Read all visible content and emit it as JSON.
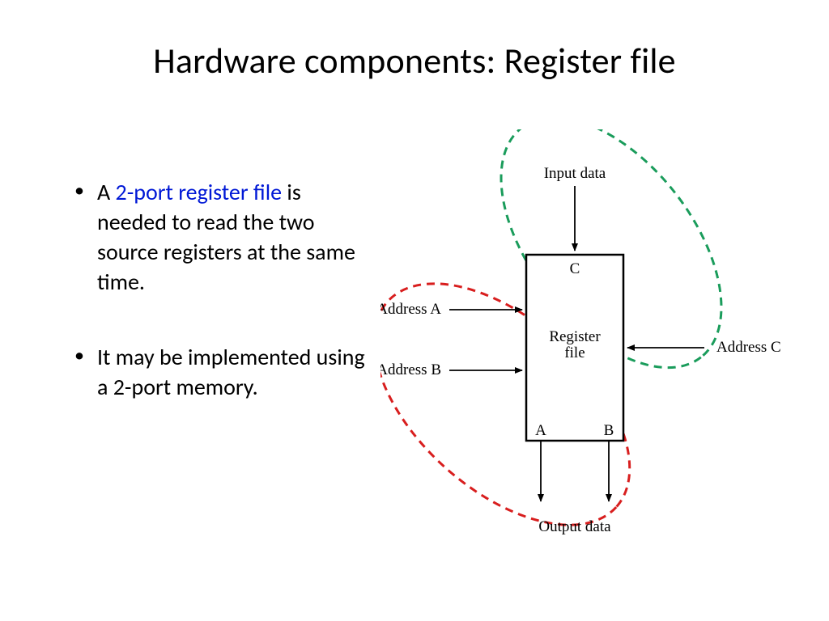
{
  "title": "Hardware components:  Register file",
  "bullets": {
    "b1_pre": "A ",
    "b1_blue": "2-port register file",
    "b1_post": " is needed to read the two source registers at the same time.",
    "b2": "It may be implemented using a 2-port memory."
  },
  "diagram": {
    "input_data": "Input data",
    "output_data": "Output data",
    "address_a": "Address A",
    "address_b": "Address B",
    "address_c": "Address C",
    "port_c": "C",
    "port_a": "A",
    "port_b": "B",
    "box_line1": "Register",
    "box_line2": "file"
  }
}
